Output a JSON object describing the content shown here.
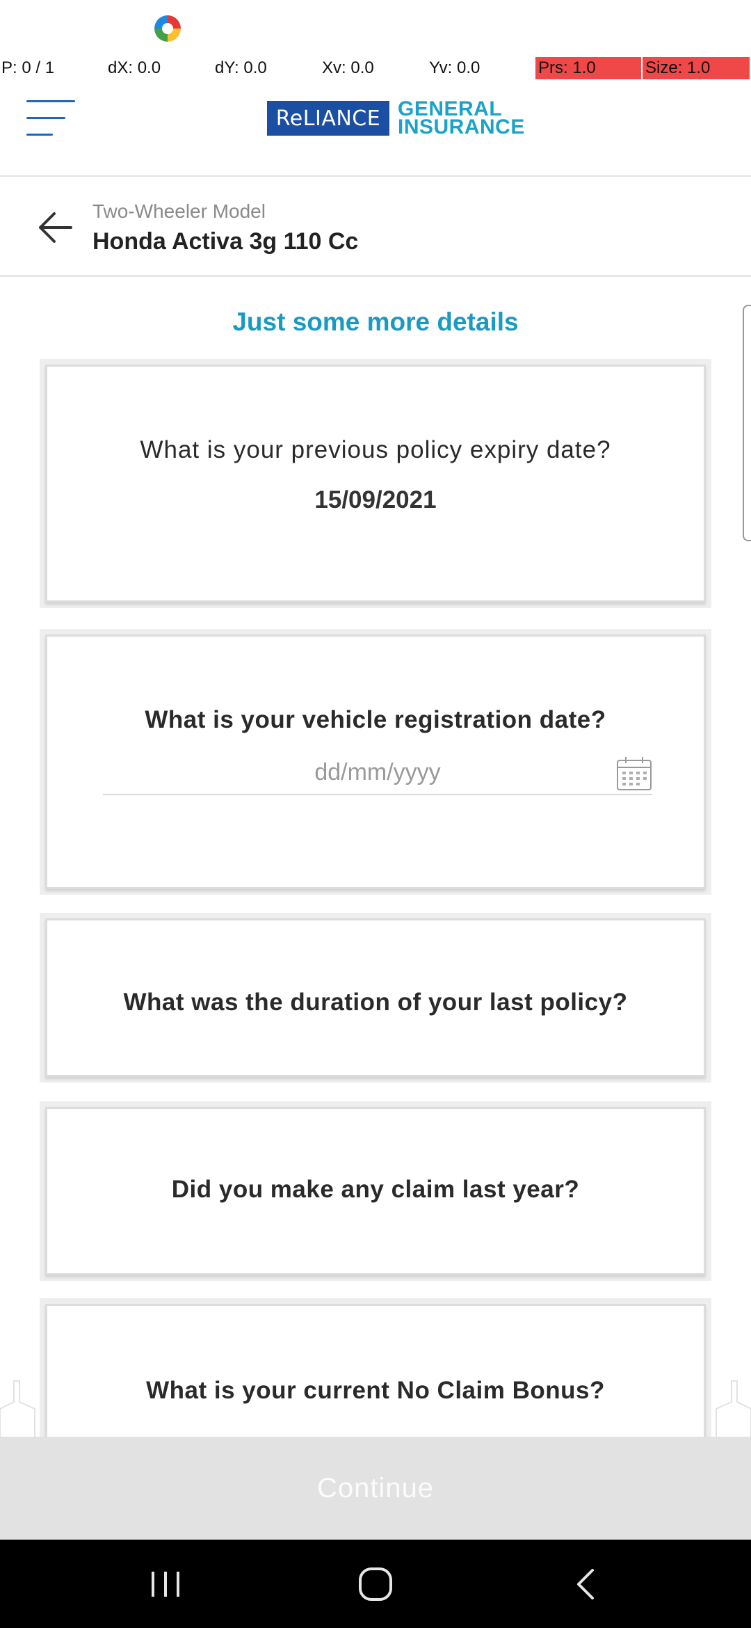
{
  "debug": {
    "p": "P: 0 / 1",
    "dx": "dX: 0.0",
    "dy": "dY: 0.0",
    "xv": "Xv: 0.0",
    "yv": "Yv: 0.0",
    "prs": "Prs: 1.0",
    "size": "Size: 1.0"
  },
  "header": {
    "logo_brand": "ReLIANCE",
    "logo_line1": "GENERAL",
    "logo_line2": "INSURANCE"
  },
  "subheader": {
    "label": "Two-Wheeler Model",
    "value": "Honda Activa 3g 110 Cc"
  },
  "content": {
    "heading": "Just some more details",
    "questions": [
      {
        "text": "What is your previous policy expiry date?",
        "answer": "15/09/2021"
      },
      {
        "text": "What is your vehicle registration date?",
        "placeholder": "dd/mm/yyyy"
      },
      {
        "text": "What was the duration of your last policy?"
      },
      {
        "text": "Did you make any claim last year?"
      },
      {
        "text": "What is your current No Claim Bonus?"
      }
    ]
  },
  "continue_label": "Continue",
  "colors": {
    "accent": "#1a9ac3",
    "brand_blue": "#1a4fa3",
    "debug_red": "#f04848",
    "continue_disabled": "#e2e2e2"
  },
  "icons": {
    "menu": "hamburger-icon",
    "back": "arrow-left-icon",
    "calendar": "calendar-icon",
    "nav_recents": "recents-icon",
    "nav_home": "home-icon",
    "nav_back": "chevron-left-icon"
  }
}
